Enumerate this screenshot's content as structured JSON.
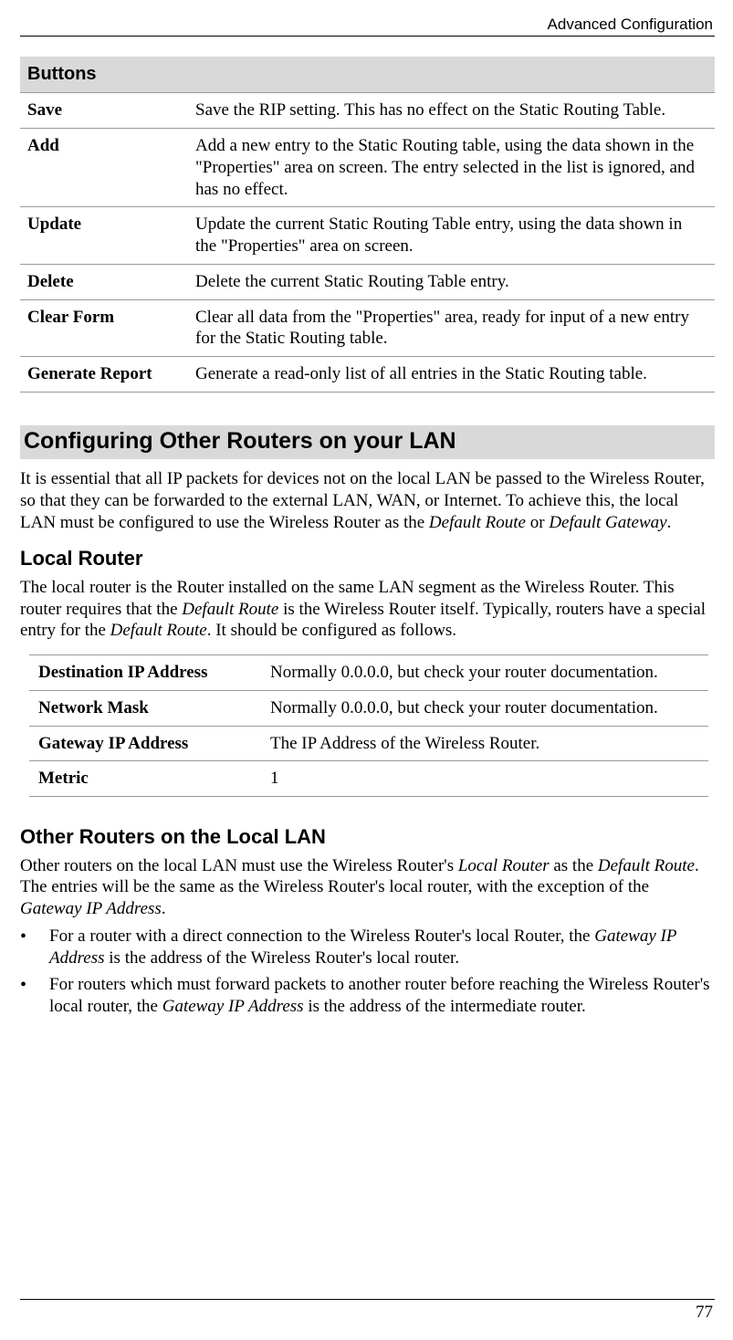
{
  "header": {
    "chapter": "Advanced Configuration"
  },
  "buttons_table": {
    "header": "Buttons",
    "rows": [
      {
        "label": "Save",
        "desc": "Save the RIP setting. This has no effect on the Static Routing Table."
      },
      {
        "label": "Add",
        "desc": "Add a new entry to the Static Routing table, using the data shown in the \"Properties\" area on screen. The entry selected in the list is ignored, and has no effect."
      },
      {
        "label": "Update",
        "desc": "Update the current Static Routing Table entry, using the data shown in the \"Properties\" area on screen."
      },
      {
        "label": "Delete",
        "desc": "Delete the current Static Routing Table entry."
      },
      {
        "label": "Clear Form",
        "desc": "Clear all data from the \"Properties\" area, ready for input of a new entry for the Static Routing table."
      },
      {
        "label": "Generate Report",
        "desc": "Generate a read-only list of all entries in the Static Routing table."
      }
    ]
  },
  "section1": {
    "heading": "Configuring Other Routers on your LAN",
    "para_parts": {
      "p1": "It is essential that all IP packets for devices not on the local LAN be passed to the Wireless Router, so that they can be forwarded to the external LAN, WAN, or Internet. To achieve this, the local LAN must be configured to use the Wireless Router as the ",
      "i1": "Default Route",
      "p2": " or ",
      "i2": "Default Gateway",
      "p3": "."
    }
  },
  "local_router": {
    "heading": "Local Router",
    "para_parts": {
      "p1": "The local router is the Router installed on the same LAN segment as the Wireless Router. This router requires that the ",
      "i1": "Default Route",
      "p2": " is the Wireless Router itself. Typically, routers have a special entry for the ",
      "i2": "Default Route",
      "p3": ". It should be configured as follows."
    },
    "table": [
      {
        "label": "Destination IP Address",
        "value": "Normally 0.0.0.0, but check your router documentation."
      },
      {
        "label": "Network Mask",
        "value": "Normally 0.0.0.0, but check your router documentation."
      },
      {
        "label": "Gateway IP Address",
        "value": "The IP Address of the Wireless Router."
      },
      {
        "label": "Metric",
        "value": "1"
      }
    ]
  },
  "other_routers": {
    "heading": "Other Routers on the Local LAN",
    "para_parts": {
      "p1": "Other routers on the local LAN must use the Wireless Router's ",
      "i1": "Local Router",
      "p2": " as the ",
      "i2": "Default Route",
      "p3": ". The entries will be the same as the Wireless Router's local router, with the exception of the ",
      "i3": "Gateway IP Address",
      "p4": "."
    },
    "bullets": [
      {
        "p1": "For a router with a direct connection to the Wireless Router's local Router, the ",
        "i1": "Gateway IP Address",
        "p2": " is the address of the Wireless Router's local router."
      },
      {
        "p1": "For routers which must forward packets to another router before reaching the Wireless Router's local router, the ",
        "i1": "Gateway IP Address",
        "p2": " is the address of the intermediate router."
      }
    ]
  },
  "footer": {
    "page_number": "77"
  }
}
